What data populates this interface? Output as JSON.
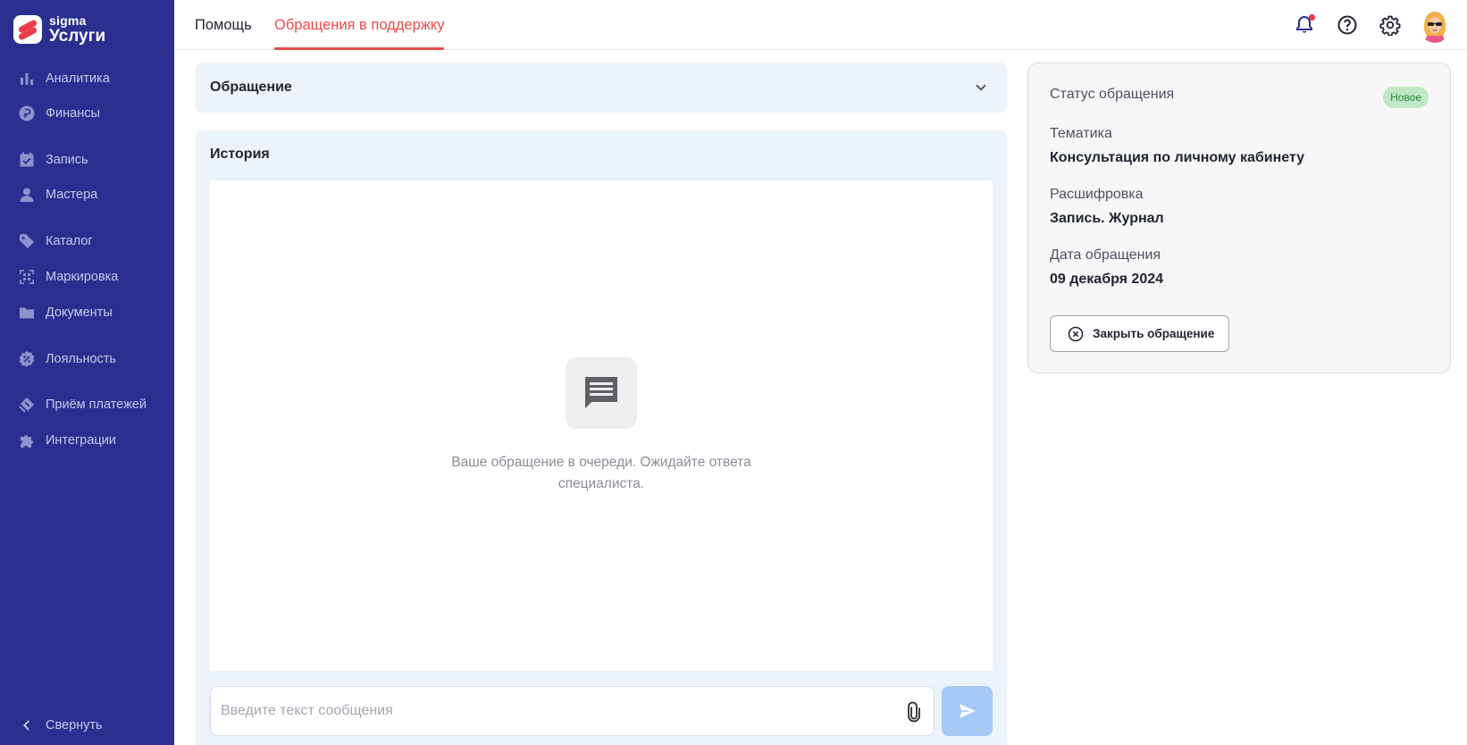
{
  "brand": {
    "line1": "sigma",
    "line2": "Услуги",
    "accent": "#ef3b4b",
    "sidebar_bg": "#2a2f8f"
  },
  "sidebar": {
    "items": [
      {
        "label": "Аналитика",
        "icon": "bar-chart-icon"
      },
      {
        "label": "Финансы",
        "icon": "ruble-coin-icon"
      },
      {
        "label": "Запись",
        "icon": "calendar-check-icon"
      },
      {
        "label": "Мастера",
        "icon": "person-icon"
      },
      {
        "label": "Каталог",
        "icon": "tag-icon"
      },
      {
        "label": "Маркировка",
        "icon": "qr-scan-icon"
      },
      {
        "label": "Документы",
        "icon": "folder-icon"
      },
      {
        "label": "Лояльность",
        "icon": "percent-badge-icon"
      },
      {
        "label": "Приём платежей",
        "icon": "payment-icon"
      },
      {
        "label": "Интеграции",
        "icon": "puzzle-icon"
      }
    ],
    "collapse_label": "Свернуть"
  },
  "topbar": {
    "tabs": [
      {
        "label": "Помощь",
        "active": false
      },
      {
        "label": "Обращения в поддержку",
        "active": true
      }
    ],
    "active_color": "#e94b4b",
    "icons": [
      "bell-icon",
      "help-circle-icon",
      "gear-icon"
    ]
  },
  "appeal": {
    "title": "Обращение"
  },
  "history": {
    "title": "История",
    "empty_text": "Ваше обращение в очереди. Ожидайте ответа специалиста.",
    "input_placeholder": "Введите текст сообщения"
  },
  "status_card": {
    "status_label": "Статус обращения",
    "status_badge": "Новое",
    "topic_label": "Тематика",
    "topic_value": "Консультация по личному кабинету",
    "decoding_label": "Расшифровка",
    "decoding_value": "Запись. Журнал",
    "date_label": "Дата обращения",
    "date_value": "09 декабря 2024",
    "close_button": "Закрыть обращение"
  }
}
